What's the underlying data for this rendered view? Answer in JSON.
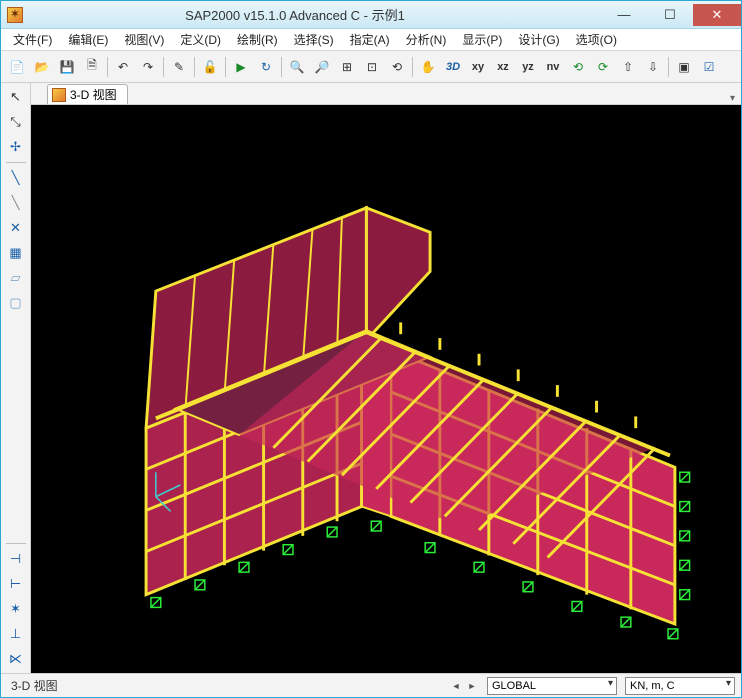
{
  "window": {
    "title": "SAP2000 v15.1.0 Advanced C  - 示例1"
  },
  "menu": {
    "items": [
      "文件(F)",
      "编辑(E)",
      "视图(V)",
      "定义(D)",
      "绘制(R)",
      "选择(S)",
      "指定(A)",
      "分析(N)",
      "显示(P)",
      "设计(G)",
      "选项(O)"
    ]
  },
  "toolbar": {
    "icons": [
      "new",
      "open",
      "save",
      "saveas",
      "undo",
      "redo",
      "pencil",
      "lock",
      "run",
      "refresh",
      "zoom-in",
      "zoom-out",
      "zoom-window",
      "zoom-extents",
      "zoom-prev",
      "pan",
      "3d",
      "xy",
      "xz",
      "yz",
      "nv",
      "rotate-ccw",
      "rotate-cw",
      "up",
      "down",
      "object",
      "check"
    ],
    "labels": {
      "xy": "xy",
      "xz": "xz",
      "yz": "yz",
      "nv": "nv",
      "3d": "3D"
    }
  },
  "left_toolbar": {
    "icons_top": [
      "pointer",
      "node-cursor",
      "move-node",
      "line-blue",
      "line-dash",
      "xbrace",
      "select-window",
      "quad",
      "square"
    ],
    "icons_bottom": [
      "snap-end",
      "snap-mid",
      "snap-int",
      "snap-perp",
      "snap-near"
    ]
  },
  "tabs": {
    "active": "3-D 视图"
  },
  "status": {
    "view_label": "3-D 视图",
    "coord_system": "GLOBAL",
    "units": "KN, m, C"
  },
  "colors": {
    "frame": "#f6e234",
    "panel": "#c8285a",
    "support": "#2bf03a"
  }
}
